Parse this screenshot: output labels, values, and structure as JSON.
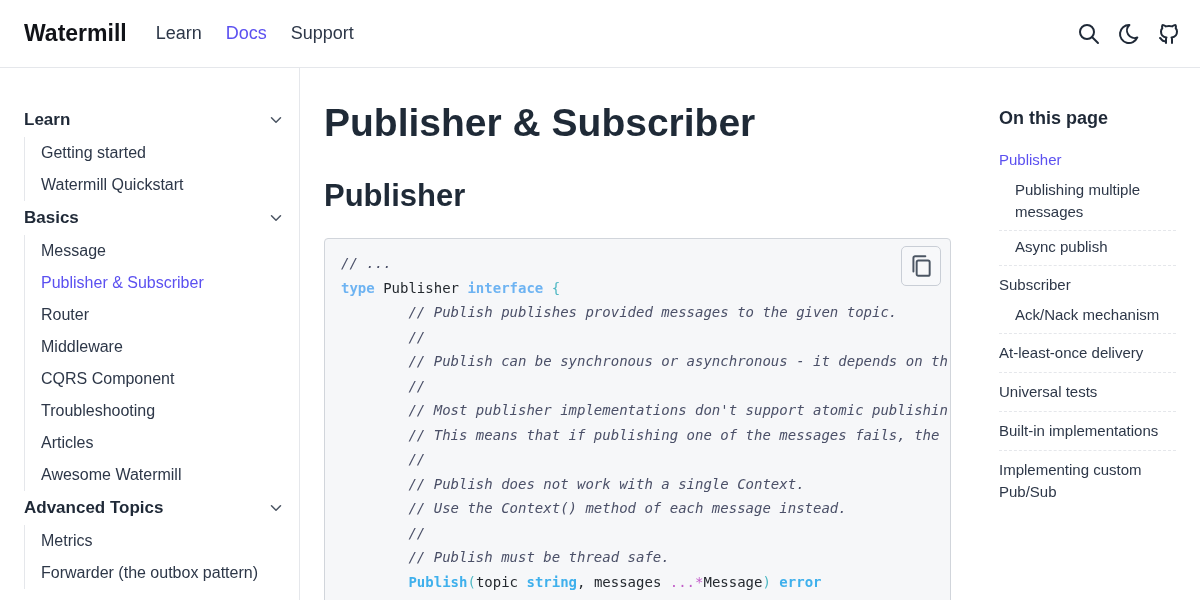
{
  "header": {
    "logo": "Watermill",
    "nav": [
      {
        "label": "Learn",
        "selected": false
      },
      {
        "label": "Docs",
        "selected": true
      },
      {
        "label": "Support",
        "selected": false
      }
    ]
  },
  "sidebar": {
    "groups": [
      {
        "title": "Learn",
        "expanded": true,
        "items": [
          {
            "label": "Getting started",
            "selected": false
          },
          {
            "label": "Watermill Quickstart",
            "selected": false
          }
        ]
      },
      {
        "title": "Basics",
        "expanded": true,
        "items": [
          {
            "label": "Message",
            "selected": false
          },
          {
            "label": "Publisher & Subscriber",
            "selected": true
          },
          {
            "label": "Router",
            "selected": false
          },
          {
            "label": "Middleware",
            "selected": false
          },
          {
            "label": "CQRS Component",
            "selected": false
          },
          {
            "label": "Troubleshooting",
            "selected": false
          },
          {
            "label": "Articles",
            "selected": false
          },
          {
            "label": "Awesome Watermill",
            "selected": false
          }
        ]
      },
      {
        "title": "Advanced Topics",
        "expanded": true,
        "items": [
          {
            "label": "Metrics",
            "selected": false
          },
          {
            "label": "Forwarder (the outbox pattern)",
            "selected": false
          }
        ]
      }
    ]
  },
  "content": {
    "title": "Publisher & Subscriber",
    "heading": "Publisher",
    "code": {
      "lines": [
        {
          "indented": false,
          "tokens": [
            {
              "kind": "comment",
              "text": "// ..."
            }
          ]
        },
        {
          "indented": false,
          "tokens": [
            {
              "kind": "keyword",
              "text": "type"
            },
            {
              "kind": "plain",
              "text": " Publisher "
            },
            {
              "kind": "keyword",
              "text": "interface"
            },
            {
              "kind": "punct",
              "text": " {"
            }
          ]
        },
        {
          "indented": true,
          "tokens": [
            {
              "kind": "comment",
              "text": "// Publish publishes provided messages to the given topic."
            }
          ]
        },
        {
          "indented": true,
          "tokens": [
            {
              "kind": "comment",
              "text": "//"
            }
          ]
        },
        {
          "indented": true,
          "tokens": [
            {
              "kind": "comment",
              "text": "// Publish can be synchronous or asynchronous - it depends on th"
            }
          ]
        },
        {
          "indented": true,
          "tokens": [
            {
              "kind": "comment",
              "text": "//"
            }
          ]
        },
        {
          "indented": true,
          "tokens": [
            {
              "kind": "comment",
              "text": "// Most publisher implementations don't support atomic publishin"
            }
          ]
        },
        {
          "indented": true,
          "tokens": [
            {
              "kind": "comment",
              "text": "// This means that if publishing one of the messages fails, the"
            }
          ]
        },
        {
          "indented": true,
          "tokens": [
            {
              "kind": "comment",
              "text": "//"
            }
          ]
        },
        {
          "indented": true,
          "tokens": [
            {
              "kind": "comment",
              "text": "// Publish does not work with a single Context."
            }
          ]
        },
        {
          "indented": true,
          "tokens": [
            {
              "kind": "comment",
              "text": "// Use the Context() method of each message instead."
            }
          ]
        },
        {
          "indented": true,
          "tokens": [
            {
              "kind": "comment",
              "text": "//"
            }
          ]
        },
        {
          "indented": true,
          "tokens": [
            {
              "kind": "comment",
              "text": "// Publish must be thread safe."
            }
          ]
        },
        {
          "indented": true,
          "tokens": [
            {
              "kind": "func",
              "text": "Publish"
            },
            {
              "kind": "punct",
              "text": "("
            },
            {
              "kind": "plain",
              "text": "topic "
            },
            {
              "kind": "type",
              "text": "string"
            },
            {
              "kind": "plain",
              "text": ", messages "
            },
            {
              "kind": "op",
              "text": "...*"
            },
            {
              "kind": "plain",
              "text": "Message"
            },
            {
              "kind": "punct",
              "text": ")"
            },
            {
              "kind": "type",
              "text": " error"
            }
          ]
        }
      ]
    }
  },
  "toc": {
    "title": "On this page",
    "items": [
      {
        "label": "Publisher",
        "selected": true,
        "children": [
          {
            "label": "Publishing multiple messages",
            "selected": false
          },
          {
            "label": "Async publish",
            "selected": false
          }
        ]
      },
      {
        "label": "Subscriber",
        "selected": false,
        "children": [
          {
            "label": "Ack/Nack mechanism",
            "selected": false
          }
        ]
      },
      {
        "label": "At-least-once delivery",
        "selected": false
      },
      {
        "label": "Universal tests",
        "selected": false
      },
      {
        "label": "Built-in implementations",
        "selected": false
      },
      {
        "label": "Implementing custom Pub/Sub",
        "selected": false
      }
    ]
  }
}
